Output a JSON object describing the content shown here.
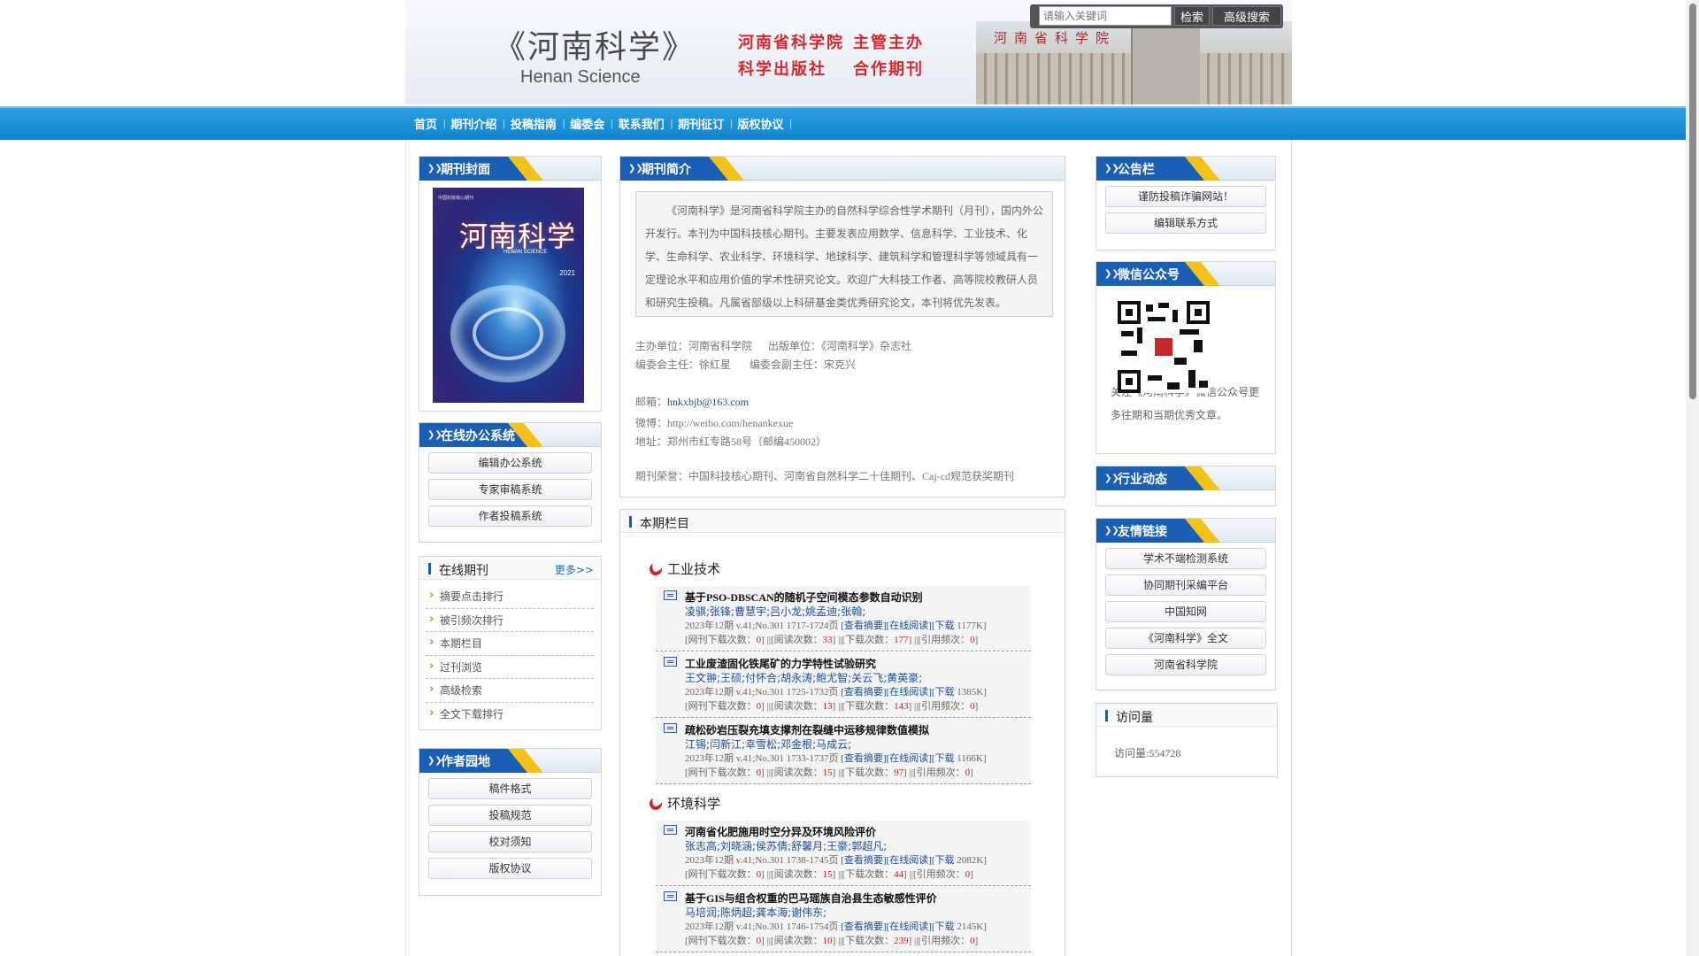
{
  "header": {
    "logo_cn": "《河南科学》",
    "logo_en": "Henan Science",
    "slogan_1": "河南省科学院",
    "slogan_2": "主管主办",
    "slogan_3": "科学出版社",
    "slogan_4": "合作期刊",
    "building_sign": "河南省科学院",
    "search": {
      "placeholder": "请输入关键词",
      "button": "检索",
      "advanced": "高级搜索"
    }
  },
  "nav": {
    "items": [
      "首页",
      "期刊介绍",
      "投稿指南",
      "编委会",
      "联系我们",
      "期刊征订",
      "版权协议"
    ],
    "separator": "|"
  },
  "left": {
    "cover_title": "期刊封面",
    "cover": {
      "title": "河南科学",
      "subtitle": "HENAN SCIENCE",
      "year": "2021"
    },
    "office_title": "在线办公系统",
    "office_items": [
      "编辑办公系统",
      "专家审稿系统",
      "作者投稿系统"
    ],
    "journal_title": "在线期刊",
    "journal_more": "更多>>",
    "journal_items": [
      "摘要点击排行",
      "被引频次排行",
      "本期栏目",
      "过刊浏览",
      "高级检索",
      "全文下载排行"
    ],
    "author_title": "作者园地",
    "author_items": [
      "稿件格式",
      "投稿规范",
      "校对须知",
      "版权协议"
    ]
  },
  "center": {
    "intro_title": "期刊简介",
    "intro_text": "《河南科学》是河南省科学院主办的自然科学综合性学术期刊（月刊），国内外公开发行。本刊为中国科技核心期刊。主要发表应用数学、信息科学、工业技术、化学、生命科学、农业科学、环境科学、地球科学、建筑科学和管理科学等领域具有一定理论水平和应用价值的学术性研究论文。欢迎广大科技工作者、高等院校教研人员和研究生投稿。凡属省部级以上科研基金类优秀研究论文，本刊将优先发表。",
    "sponsor": "主办单位：河南省科学院",
    "publisher": "出版单位：《河南科学》杂志社",
    "editor_chief": "编委会主任：徐红星",
    "editor_deputy": "编委会副主任：宋克兴",
    "email_label": "邮箱：",
    "email": "hnkxbjb@163.com",
    "weibo": "微博：http://weibo.com/henankexue",
    "address": "地址：郑州市红专路58号（邮编450002）",
    "honors": "期刊荣誉：中国科技核心期刊、河南省自然科学二十佳期刊、Caj-cd规范获奖期刊",
    "issue_title": "本期栏目",
    "sections": [
      {
        "name": "工业技术",
        "articles": [
          {
            "title": "基于PSO-DBSCAN的随机子空间模态参数自动识别",
            "authors": "凌骐;张锋;曹慧宇;吕小龙;姚孟迪;张翰;",
            "meta": "2023年12期 v.41;No.301 1717-1724页",
            "links": "[查看摘要][在线阅读][下载",
            "size": "1177K]",
            "dl": "0",
            "reads": "33",
            "downloads": "177",
            "cites": "0"
          },
          {
            "title": "工业废渣固化铁尾矿的力学特性试验研究",
            "authors": "王文翀;王硕;付怀合;胡永涛;鲍尤智;关云飞;黄英豪;",
            "meta": "2023年12期 v.41;No.301 1725-1732页",
            "links": "[查看摘要][在线阅读][下载",
            "size": "1385K]",
            "dl": "0",
            "reads": "13",
            "downloads": "143",
            "cites": "0"
          },
          {
            "title": "疏松砂岩压裂充填支撑剂在裂缝中运移规律数值模拟",
            "authors": "江锡;闫新江;幸雪松;邓金根;马成云;",
            "meta": "2023年12期 v.41;No.301 1733-1737页",
            "links": "[查看摘要][在线阅读][下载",
            "size": "1166K]",
            "dl": "0",
            "reads": "15",
            "downloads": "97",
            "cites": "0"
          }
        ]
      },
      {
        "name": "环境科学",
        "articles": [
          {
            "title": "河南省化肥施用时空分异及环境风险评价",
            "authors": "张志高;刘晓涵;侯苏倩;舒馨月;王豪;郭超凡;",
            "meta": "2023年12期 v.41;No.301 1738-1745页",
            "links": "[查看摘要][在线阅读][下载",
            "size": "2082K]",
            "dl": "0",
            "reads": "15",
            "downloads": "44",
            "cites": "0"
          },
          {
            "title": "基于GIS与组合权重的巴马瑶族自治县生态敏感性评价",
            "authors": "马培润;陈炳超;龚本海;谢伟东;",
            "meta": "2023年12期 v.41;No.301 1746-1754页",
            "links": "[查看摘要][在线阅读][下载",
            "size": "2145K]",
            "dl": "0",
            "reads": "10",
            "downloads": "239",
            "cites": "0"
          }
        ]
      }
    ],
    "stat_labels": {
      "dl": "[网刊下载次数：",
      "reads": "] ||[阅读次数：",
      "downloads": "] ||[下载次数：",
      "cites": "] ||[引用频次：",
      "end": "]"
    }
  },
  "right": {
    "notice_title": "公告栏",
    "notice_items": [
      "谨防投稿诈骗网站！",
      "编辑联系方式"
    ],
    "wechat_title": "微信公众号",
    "wechat_text": "关注《河南科学》微信公众号更多往期和当期优秀文章。",
    "industry_title": "行业动态",
    "links_title": "友情链接",
    "links_items": [
      "学术不端检测系统",
      "协同期刊采编平台",
      "中国知网",
      "《河南科学》全文",
      "河南省科学院"
    ],
    "visits_title": "访问量",
    "visits_text": "访问量:554728"
  }
}
